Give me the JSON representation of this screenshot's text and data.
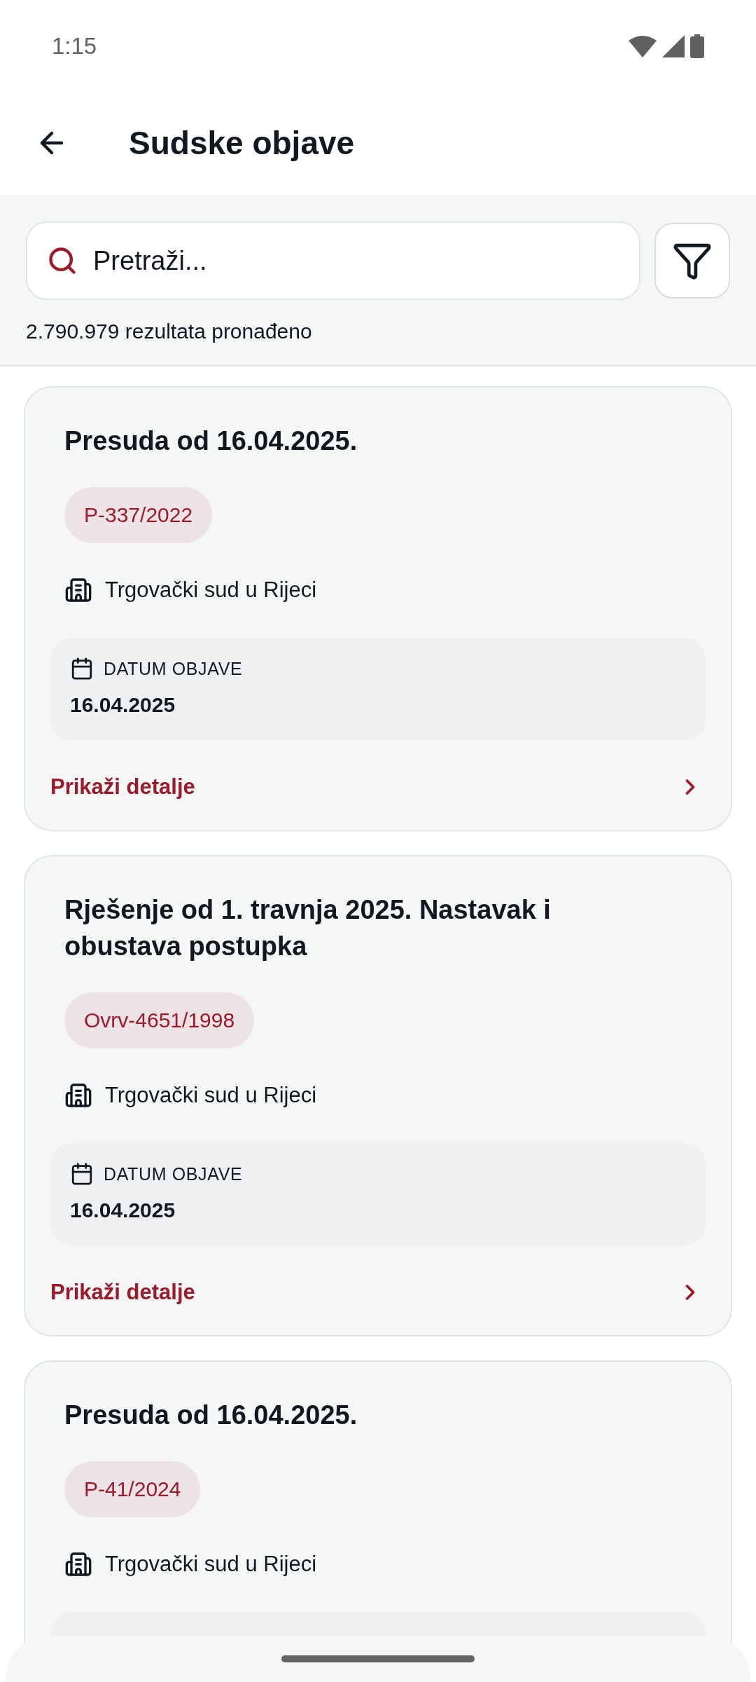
{
  "status_bar": {
    "time": "1:15"
  },
  "top_bar": {
    "title": "Sudske objave"
  },
  "search": {
    "placeholder": "Pretraži...",
    "result_count": "2.790.979 rezultata pronađeno"
  },
  "cards": [
    {
      "title": "Presuda od 16.04.2025.",
      "case_number": "P-337/2022",
      "court": "Trgovački sud u Rijeci",
      "date_label": "DATUM OBJAVE",
      "date": "16.04.2025",
      "link": "Prikaži detalje"
    },
    {
      "title": "Rješenje od 1. travnja 2025. Nastavak i obustava postupka",
      "case_number": "Ovrv-4651/1998",
      "court": "Trgovački sud u Rijeci",
      "date_label": "DATUM OBJAVE",
      "date": "16.04.2025",
      "link": "Prikaži detalje"
    },
    {
      "title": "Presuda od 16.04.2025.",
      "case_number": "P-41/2024",
      "court": "Trgovački sud u Rijeci"
    }
  ]
}
